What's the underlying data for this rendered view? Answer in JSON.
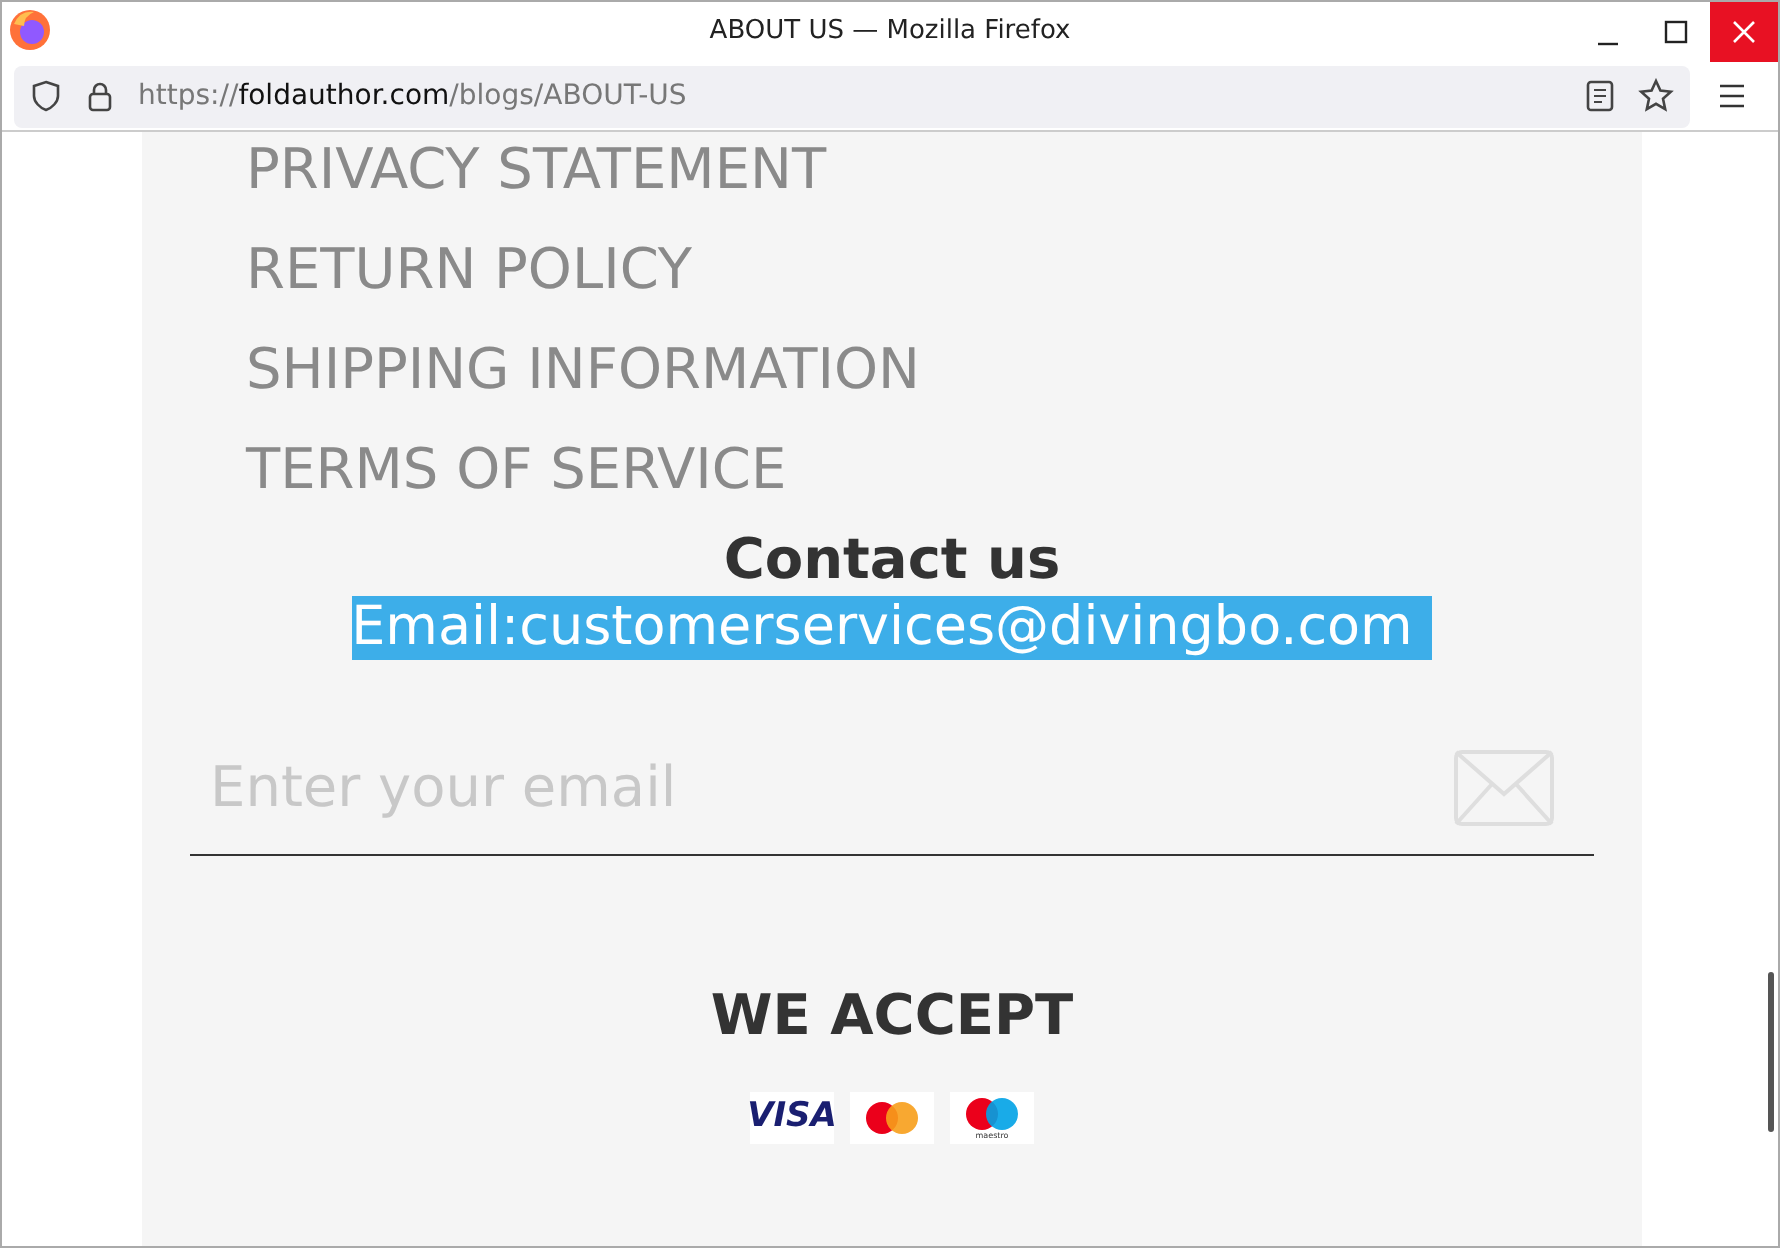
{
  "window": {
    "title": "ABOUT US — Mozilla Firefox"
  },
  "address_bar": {
    "url_prefix": "https://",
    "url_domain": "foldauthor.com",
    "url_path": "/blogs/ABOUT-US"
  },
  "footer_links": [
    "PRIVACY STATEMENT",
    "RETURN POLICY",
    "SHIPPING INFORMATION",
    "TERMS OF SERVICE"
  ],
  "contact": {
    "heading": "Contact us",
    "email_line": "Email:customerservices@divingbo.com",
    "email_selected": true
  },
  "newsletter": {
    "placeholder": "Enter your email"
  },
  "accept": {
    "heading": "WE ACCEPT",
    "cards": [
      {
        "kind": "visa",
        "label": "VISA"
      },
      {
        "kind": "mastercard"
      },
      {
        "kind": "maestro",
        "label": "maestro"
      }
    ]
  }
}
